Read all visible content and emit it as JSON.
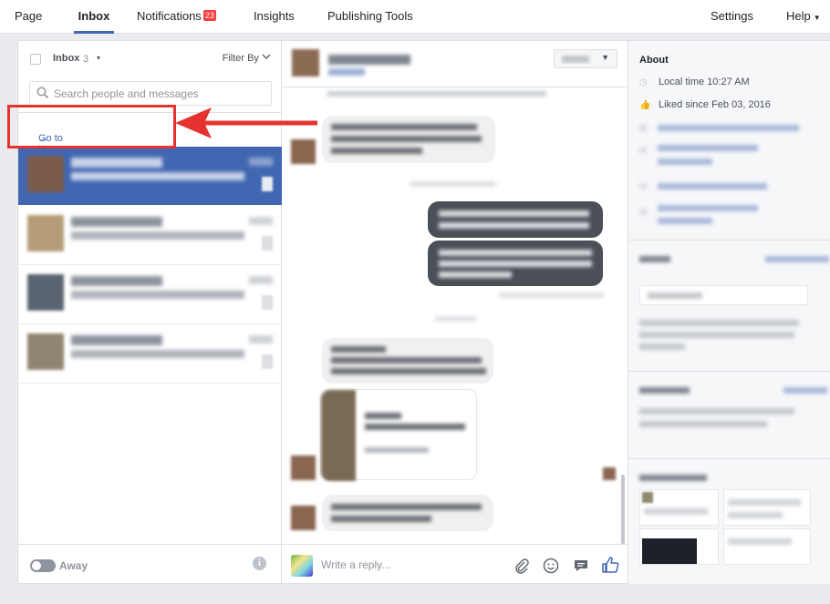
{
  "nav": {
    "page": "Page",
    "inbox": "Inbox",
    "notifications": "Notifications",
    "notifications_badge": "23",
    "insights": "Insights",
    "publishing_tools": "Publishing Tools",
    "settings": "Settings",
    "help": "Help"
  },
  "inbox_header": {
    "label": "Inbox",
    "count": "3",
    "filter": "Filter By"
  },
  "search": {
    "placeholder": "Search people and messages"
  },
  "new_inbox": {
    "label": "Go to New Inbox",
    "arrow": "→"
  },
  "footer_left": {
    "away": "Away",
    "info": "i"
  },
  "composer": {
    "placeholder": "Write a reply..."
  },
  "about": {
    "title": "About",
    "local_time": "Local time 10:27 AM",
    "liked_since": "Liked since Feb 03, 2016"
  },
  "colors": {
    "accent": "#4267b2",
    "badge": "#fa3e3e",
    "annotation": "#e4322e"
  },
  "icons": {
    "search": "search-icon",
    "clock": "clock-icon",
    "thumb": "thumbs-up-icon",
    "attach": "paperclip-icon",
    "emoji": "smiley-icon",
    "sticker": "sticker-icon",
    "like": "like-icon"
  }
}
